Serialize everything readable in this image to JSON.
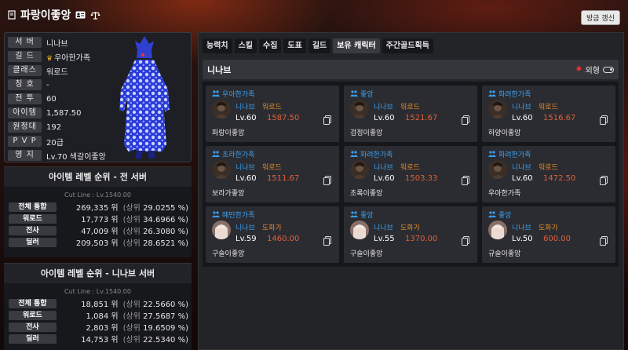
{
  "header": {
    "title": "파랑이좋앙",
    "refresh_label": "방금 갱신"
  },
  "profile": {
    "rows": [
      {
        "label": "서  버",
        "value": "니나브"
      },
      {
        "label": "길  드",
        "value": "우아한가족"
      },
      {
        "label": "클래스",
        "value": "워로드"
      },
      {
        "label": "칭  호",
        "value": "-"
      },
      {
        "label": "전  투",
        "value": "60"
      },
      {
        "label": "아이템",
        "value": "1,587.50"
      },
      {
        "label": "원정대",
        "value": "192"
      },
      {
        "label": "P V P",
        "value": "20급"
      },
      {
        "label": "영  지",
        "value": "Lv.70 색갈이좋앙"
      }
    ]
  },
  "ranking_all": {
    "title": "아이템 레벨 순위 - 전 서버",
    "cutline": "Cut Line : Lv.1540.00",
    "rows": [
      {
        "cat": "전체 통합",
        "rank": "269,335 위",
        "pct_prefix": "(상위",
        "pct": "29.0255 %)"
      },
      {
        "cat": "워로드",
        "rank": "17,773 위",
        "pct_prefix": "(상위",
        "pct": "34.6966 %)"
      },
      {
        "cat": "전사",
        "rank": "47,009 위",
        "pct_prefix": "(상위",
        "pct": "26.3080 %)"
      },
      {
        "cat": "딜러",
        "rank": "209,503 위",
        "pct_prefix": "(상위",
        "pct": "28.6521 %)"
      }
    ]
  },
  "ranking_server": {
    "title": "아이템 레벨 순위 - 니나브 서버",
    "cutline": "Cut Line : Lv.1540.00",
    "rows": [
      {
        "cat": "전체 통합",
        "rank": "18,851 위",
        "pct_prefix": "(상위",
        "pct": "22.5660 %)"
      },
      {
        "cat": "워로드",
        "rank": "1,084 위",
        "pct_prefix": "(상위",
        "pct": "27.5687 %)"
      },
      {
        "cat": "전사",
        "rank": "2,803 위",
        "pct_prefix": "(상위",
        "pct": "19.6509 %)"
      },
      {
        "cat": "딜러",
        "rank": "14,753 위",
        "pct_prefix": "(상위",
        "pct": "22.5340 %)"
      }
    ]
  },
  "tabs": [
    "능력치",
    "스킬",
    "수집",
    "도표",
    "길드",
    "보유 캐릭터",
    "주간골드획득"
  ],
  "active_tab": "보유 캐릭터",
  "server_bar": {
    "name": "니나브",
    "appearance_label": "외형"
  },
  "characters": [
    {
      "guild": "우아한가족",
      "server": "니나브",
      "class": "워로드",
      "level": "Lv.60",
      "item_level": "1587.50",
      "name": "파랑이좋앙",
      "portrait": "dark"
    },
    {
      "guild": "좋앙",
      "server": "니나브",
      "class": "워로드",
      "level": "Lv.60",
      "item_level": "1521.67",
      "name": "검정이좋앙",
      "portrait": "dark"
    },
    {
      "guild": "화려한가족",
      "server": "니나브",
      "class": "워로드",
      "level": "Lv.60",
      "item_level": "1516.67",
      "name": "하양이좋앙",
      "portrait": "dark"
    },
    {
      "guild": "초라한가족",
      "server": "니나브",
      "class": "워로드",
      "level": "Lv.60",
      "item_level": "1511.67",
      "name": "보라가좋앙",
      "portrait": "dark"
    },
    {
      "guild": "화려한가족",
      "server": "니나브",
      "class": "워로드",
      "level": "Lv.60",
      "item_level": "1503.33",
      "name": "초록이좋앙",
      "portrait": "dark"
    },
    {
      "guild": "화려한가족",
      "server": "니나브",
      "class": "워로드",
      "level": "Lv.60",
      "item_level": "1472.50",
      "name": "우아한가족",
      "portrait": "dark"
    },
    {
      "guild": "예민한가족",
      "server": "니나브",
      "class": "도화가",
      "level": "Lv.59",
      "item_level": "1460.00",
      "name": "구슬이좋앙",
      "portrait": "light"
    },
    {
      "guild": "좋앙",
      "server": "니나브",
      "class": "도화가",
      "level": "Lv.55",
      "item_level": "1370.00",
      "name": "구슬이좋앙",
      "portrait": "light"
    },
    {
      "guild": "좋앙",
      "server": "니나브",
      "class": "도화가",
      "level": "Lv.50",
      "item_level": "600.00",
      "name": "규슬이좋앙",
      "portrait": "light"
    }
  ],
  "colors": {
    "guild_blue": "#3aa0f0",
    "class_orange": "#e08a2a",
    "item_level_red": "#e0603a"
  }
}
